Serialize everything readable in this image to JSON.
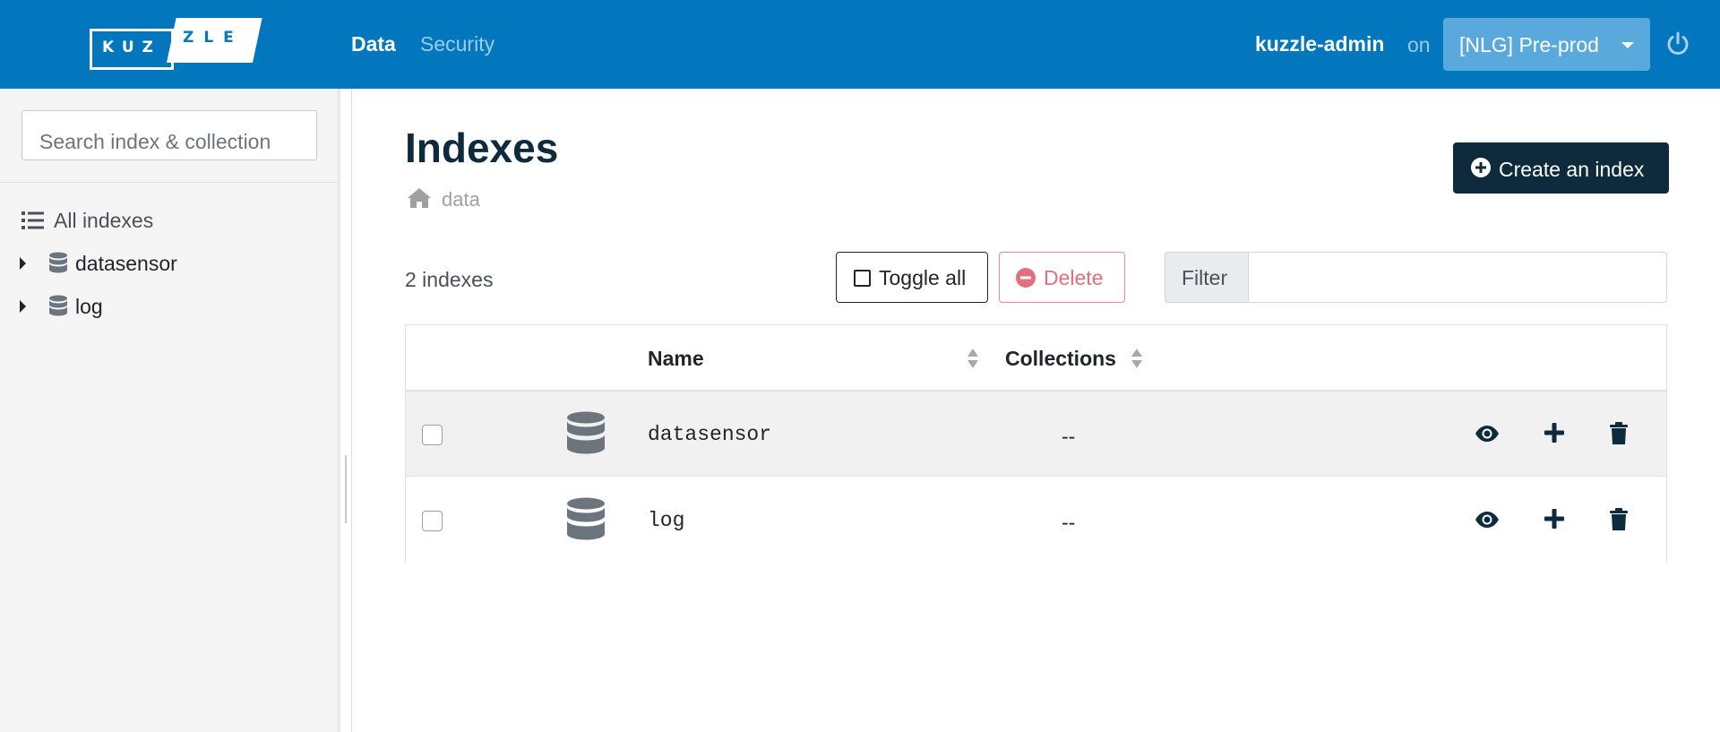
{
  "header": {
    "logo_left": "KUZ",
    "logo_right": "ZLE",
    "nav": [
      {
        "label": "Data",
        "active": true
      },
      {
        "label": "Security",
        "active": false
      }
    ],
    "user": "kuzzle-admin",
    "on": "on",
    "environment": "[NLG] Pre-prod",
    "power_icon": "power-icon",
    "bg_color": "#0277bd"
  },
  "sidebar": {
    "search_placeholder": "Search index & collection",
    "all_indexes_label": "All indexes",
    "tree": [
      {
        "label": "datasensor",
        "icon": "database-icon"
      },
      {
        "label": "log",
        "icon": "database-icon"
      }
    ]
  },
  "main": {
    "title": "Indexes",
    "breadcrumb": "data",
    "create_button": "Create an index",
    "count_label": "2 indexes",
    "toggle_all": "Toggle all",
    "delete": "Delete",
    "filter_label": "Filter",
    "filter_value": "",
    "table": {
      "columns": [
        "Name",
        "Collections"
      ],
      "rows": [
        {
          "name": "datasensor",
          "collections": "--"
        },
        {
          "name": "log",
          "collections": "--"
        }
      ],
      "actions": [
        "eye-icon",
        "plus-icon",
        "trash-icon"
      ]
    },
    "accent_color": "#0d2b3c",
    "danger_color": "#e0707e"
  }
}
